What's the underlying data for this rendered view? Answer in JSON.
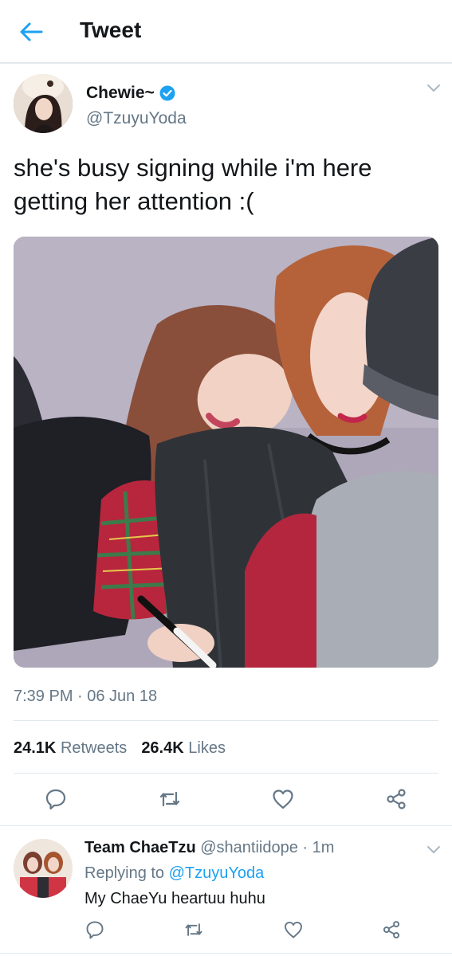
{
  "header": {
    "title": "Tweet",
    "back_icon": "arrow-left-icon"
  },
  "tweet": {
    "display_name": "Chewie~",
    "handle": "@TzuyuYoda",
    "text_line1": "she's busy signing while i'm here",
    "text_line2": "getting her attention :(",
    "timestamp": "7:39 PM · 06 Jun 18",
    "retweets_count": "24.1K",
    "retweets_label": "Retweets",
    "likes_count": "26.4K",
    "likes_label": "Likes"
  },
  "reply": {
    "display_name": "Team ChaeTzu",
    "meta": "@shantiidope · 1m",
    "replying_label": "Replying to",
    "replying_mention": "@TzuyuYoda",
    "text": "My ChaeYu heartuu huhu"
  },
  "colors": {
    "accent": "#1da1f2",
    "muted": "#657786",
    "text": "#14171a",
    "divider": "#e1e8ed"
  }
}
